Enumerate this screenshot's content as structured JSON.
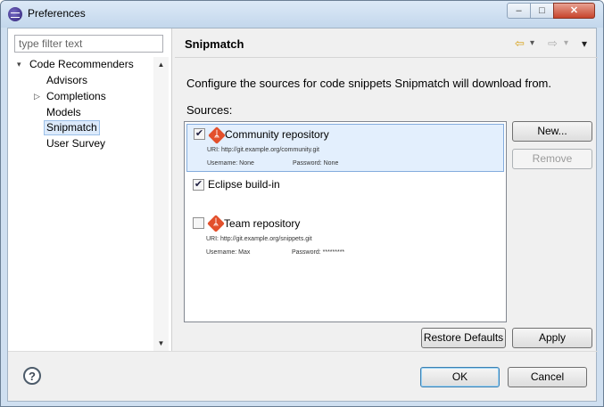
{
  "window": {
    "title": "Preferences",
    "buttons": {
      "minimize": "–",
      "maximize": "□",
      "close": "✕"
    }
  },
  "sidebar": {
    "filter_placeholder": "type filter text",
    "tree": [
      {
        "label": "Code Recommenders",
        "expander": "▾"
      },
      {
        "label": "Advisors"
      },
      {
        "label": "Completions",
        "expander": "▷"
      },
      {
        "label": "Models"
      },
      {
        "label": "Snipmatch",
        "selected": true
      },
      {
        "label": "User Survey"
      }
    ]
  },
  "page": {
    "title": "Snipmatch",
    "nav": {
      "back": "⇦",
      "forward": "⇨",
      "dropdown": "▾",
      "menu": "▾"
    },
    "description": "Configure the sources for code snippets Snipmatch will download from.",
    "sources_label": "Sources:",
    "sources": [
      {
        "name": "Community repository",
        "checked": true,
        "icon": "git-icon",
        "uri": "URI: http://git.example.org/community.git",
        "username": "Username: None",
        "password": "Password: None"
      },
      {
        "name": "Eclipse build-in",
        "checked": true
      },
      {
        "name": "Team repository",
        "checked": false,
        "icon": "git-icon",
        "uri": "URI: http://git.example.org/snippets.git",
        "username": "Username: Max",
        "password": "Password: *********"
      }
    ],
    "buttons": {
      "new": "New...",
      "remove": "Remove",
      "restore_defaults": "Restore Defaults",
      "apply": "Apply"
    }
  },
  "footer": {
    "help": "?",
    "ok": "OK",
    "cancel": "Cancel"
  },
  "colors": {
    "titlebar": "#c3d7ec",
    "selection": "#e3effd",
    "git_icon": "#e3502c"
  }
}
